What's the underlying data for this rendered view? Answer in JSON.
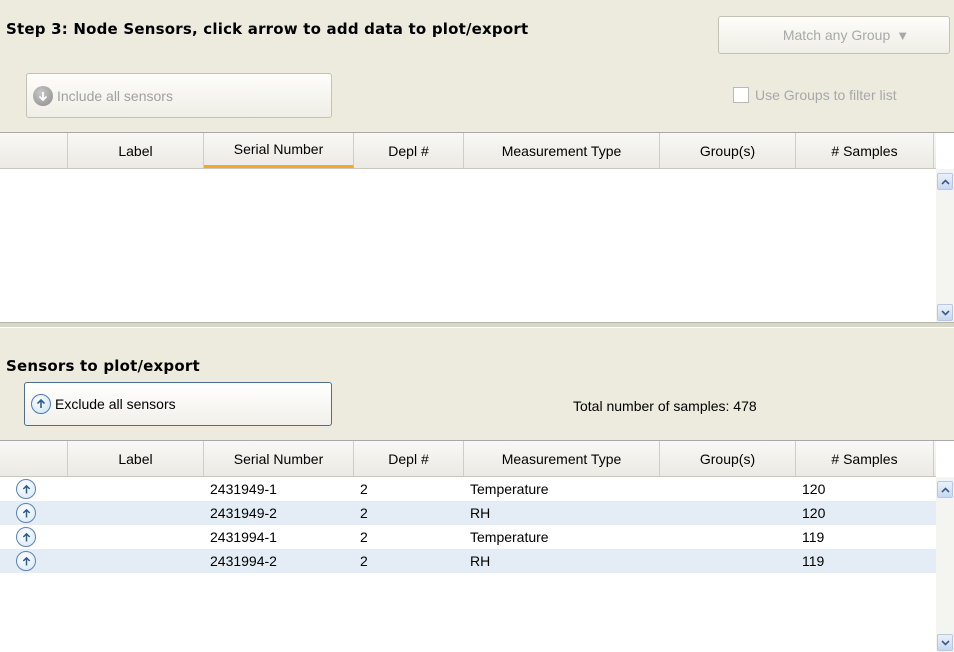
{
  "node_sensors": {
    "title": "Step 3: Node Sensors, click arrow to add data to plot/export",
    "match_group_label": "Match any Group",
    "include_all_label": "Include all sensors",
    "use_groups_label": "Use Groups to filter list",
    "columns": [
      "",
      "Label",
      "Serial Number",
      "Depl #",
      "Measurement Type",
      "Group(s)",
      "# Samples"
    ],
    "sorted_column": "Serial Number",
    "rows": []
  },
  "plot_export": {
    "title": "Sensors to plot/export",
    "exclude_all_label": "Exclude all sensors",
    "total_samples_text": "Total number of samples: 478",
    "columns": [
      "",
      "Label",
      "Serial Number",
      "Depl #",
      "Measurement Type",
      "Group(s)",
      "# Samples"
    ],
    "rows": [
      {
        "label": "",
        "serial": "2431949-1",
        "depl": "2",
        "measurement": "Temperature",
        "groups": "",
        "samples": "120"
      },
      {
        "label": "",
        "serial": "2431949-2",
        "depl": "2",
        "measurement": "RH",
        "groups": "",
        "samples": "120"
      },
      {
        "label": "",
        "serial": "2431994-1",
        "depl": "2",
        "measurement": "Temperature",
        "groups": "",
        "samples": "119"
      },
      {
        "label": "",
        "serial": "2431994-2",
        "depl": "2",
        "measurement": "RH",
        "groups": "",
        "samples": "119"
      }
    ]
  },
  "colors": {
    "panel_bg": "#ecebde",
    "sorted_indicator": "#f5a531",
    "alt_row": "#e4ecf5",
    "button_border_active": "#4f6e8e"
  },
  "icons": {
    "include_all": "circle-down-arrow-icon",
    "exclude_all": "circle-up-arrow-icon",
    "row_action": "circle-up-arrow-icon",
    "dropdown": "triangle-down-icon",
    "scroll_up": "scroll-up-icon",
    "scroll_down": "scroll-down-icon"
  }
}
